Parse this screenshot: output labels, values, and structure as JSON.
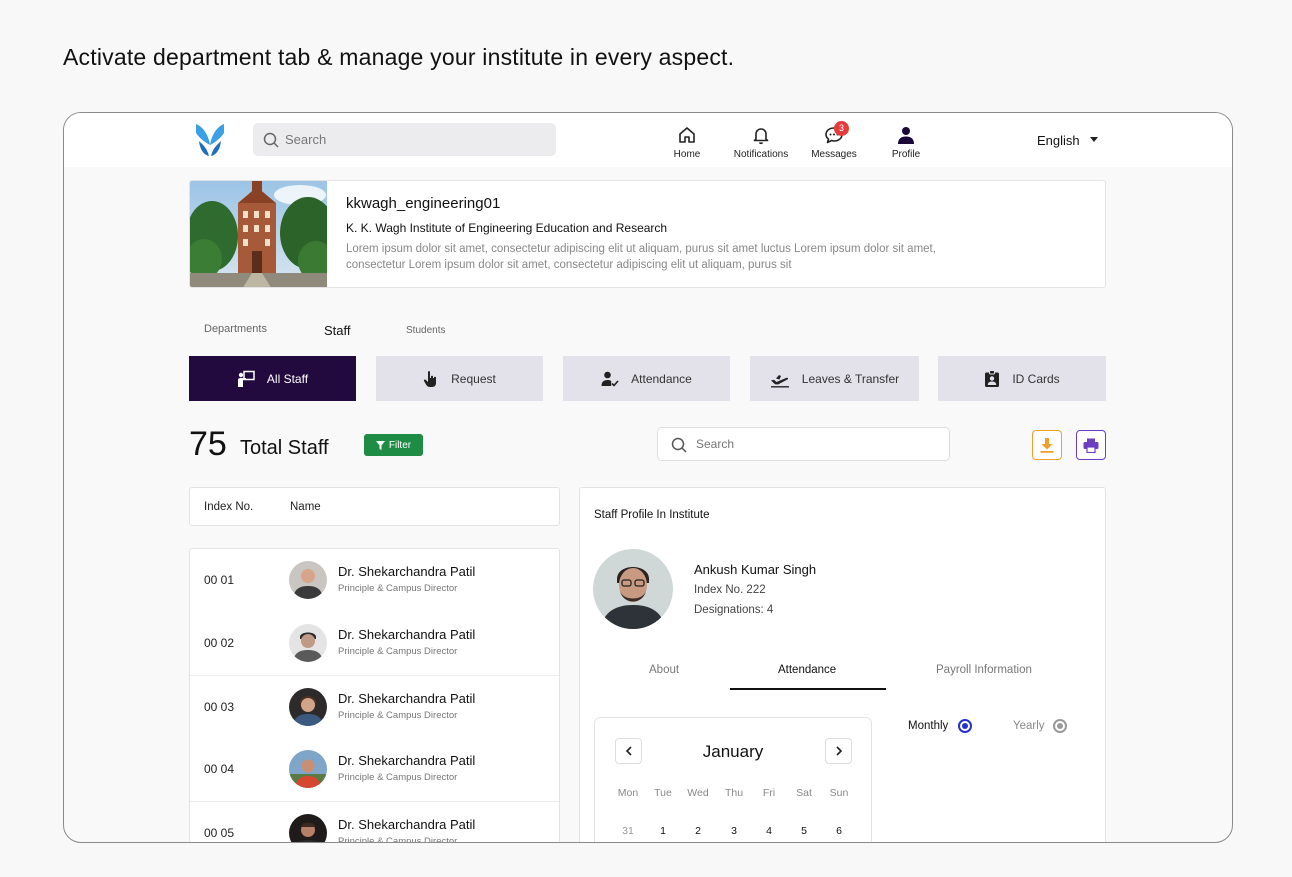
{
  "caption": "Activate department tab & manage your institute in every aspect.",
  "header": {
    "search_placeholder": "Search",
    "nav": {
      "home": "Home",
      "notifications": "Notifications",
      "messages": "Messages",
      "profile": "Profile"
    },
    "messages_badge": "3",
    "language": "English"
  },
  "institute": {
    "username": "kkwagh_engineering01",
    "name": "K. K. Wagh Institute of Engineering Education and Research",
    "description": "Lorem ipsum dolor sit amet, consectetur adipiscing elit ut aliquam, purus sit amet luctus Lorem ipsum dolor sit amet, consectetur Lorem ipsum dolor sit amet, consectetur adipiscing elit ut aliquam, purus sit"
  },
  "primary_tabs": {
    "departments": "Departments",
    "staff": "Staff",
    "students": "Students"
  },
  "staff_tabs": {
    "all_staff": "All Staff",
    "request": "Request",
    "attendance": "Attendance",
    "leaves": "Leaves & Transfer",
    "id_cards": "ID Cards"
  },
  "summary": {
    "count": "75",
    "label": "Total Staff",
    "filter": "Filter",
    "search_placeholder": "Search"
  },
  "list_header": {
    "index": "Index No.",
    "name": "Name"
  },
  "staff": [
    {
      "index": "00 01",
      "name": "Dr. Shekarchandra Patil",
      "role": "Principle & Campus Director"
    },
    {
      "index": "00 02",
      "name": "Dr. Shekarchandra Patil",
      "role": "Principle & Campus Director"
    },
    {
      "index": "00 03",
      "name": "Dr. Shekarchandra Patil",
      "role": "Principle & Campus Director"
    },
    {
      "index": "00 04",
      "name": "Dr. Shekarchandra Patil",
      "role": "Principle & Campus Director"
    },
    {
      "index": "00 05",
      "name": "Dr. Shekarchandra Patil",
      "role": "Principle & Campus Director"
    }
  ],
  "profile": {
    "title": "Staff Profile In Institute",
    "name": "Ankush Kumar Singh",
    "index": "Index No. 222",
    "designations": "Designations: 4",
    "tabs": {
      "about": "About",
      "attendance": "Attendance",
      "payroll": "Payroll Information"
    }
  },
  "calendar": {
    "month": "January",
    "weekdays": [
      "Mon",
      "Tue",
      "Wed",
      "Thu",
      "Fri",
      "Sat",
      "Sun"
    ],
    "first_row": [
      "31",
      "1",
      "2",
      "3",
      "4",
      "5",
      "6"
    ]
  },
  "period": {
    "monthly": "Monthly",
    "yearly": "Yearly",
    "selected": "monthly"
  },
  "colors": {
    "primary": "#220a3f",
    "filter": "#1f8c45",
    "download": "#f0a02a",
    "print": "#6a3fc0",
    "logo": "#3aa0e6",
    "badge": "#e43c3c"
  }
}
